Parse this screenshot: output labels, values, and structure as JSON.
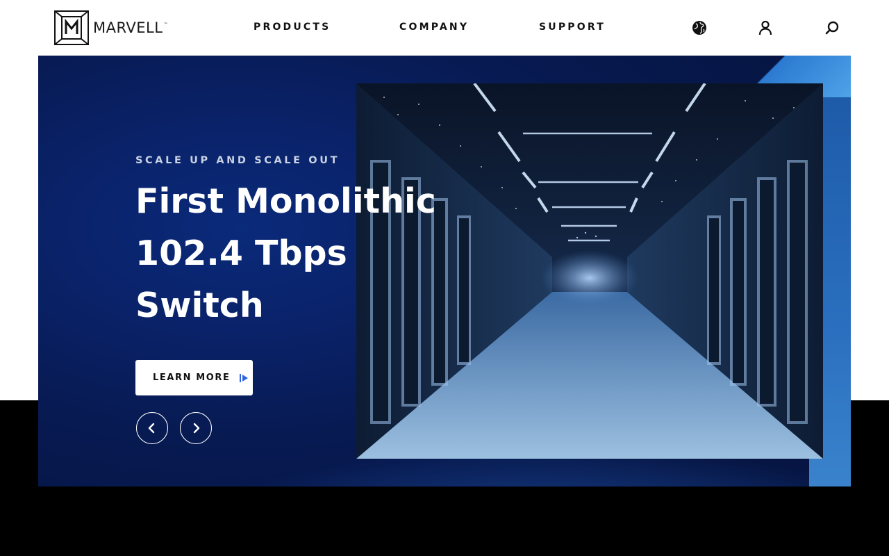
{
  "header": {
    "logo": {
      "text": "MARVELL",
      "trademark": "™"
    },
    "nav": [
      {
        "label": "PRODUCTS"
      },
      {
        "label": "COMPANY"
      },
      {
        "label": "SUPPORT"
      }
    ],
    "icons": {
      "language": "globe-icon",
      "account": "user-icon",
      "search": "search-icon"
    }
  },
  "hero": {
    "eyebrow": "SCALE UP AND SCALE OUT",
    "headline": [
      "First Monolithic",
      "102.4 Tbps",
      "Switch"
    ],
    "cta_label": "LEARN MORE",
    "prev_icon": "chevron-left-icon",
    "next_icon": "chevron-right-icon"
  },
  "colors": {
    "hero_bg": "#0a2269",
    "accent": "#2f63e0",
    "text_light": "#ffffff",
    "eyebrow": "#c8d2e4"
  }
}
